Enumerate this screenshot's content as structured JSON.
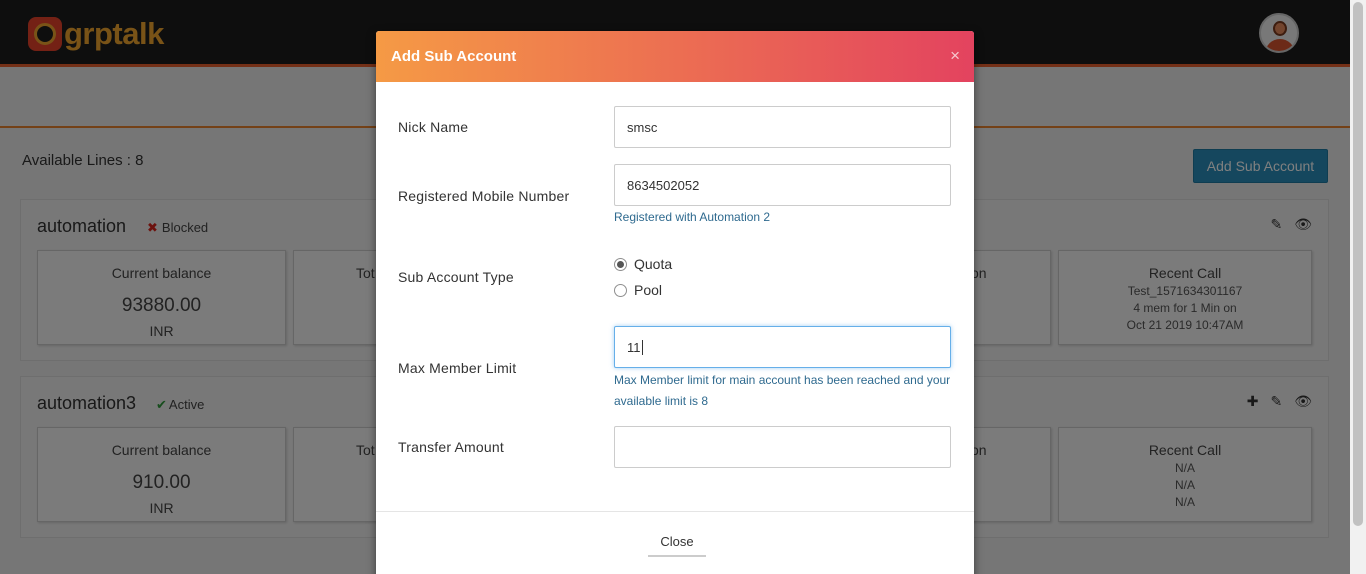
{
  "app": {
    "logo_text": "grptalk"
  },
  "page": {
    "available_lines_label": "Available Lines : 8",
    "add_sub_account_label": "Add Sub Account"
  },
  "accounts": [
    {
      "name": "automation",
      "status": "Blocked",
      "current_balance_title": "Current balance",
      "current_balance_value": "93880.00",
      "current_balance_unit": "INR",
      "partial_tile_1": "Tot",
      "partial_tile_3": "tion",
      "recent_call_title": "Recent Call",
      "recent_call_lines": [
        "Test_1571634301167",
        "4 mem for 1 Min on",
        "Oct 21 2019 10:47AM"
      ]
    },
    {
      "name": "automation3",
      "status": "Active",
      "current_balance_title": "Current balance",
      "current_balance_value": "910.00",
      "current_balance_unit": "INR",
      "partial_tile_1": "Tot",
      "partial_tile_3": "tion",
      "recent_call_title": "Recent Call",
      "recent_call_lines": [
        "N/A",
        "N/A",
        "N/A"
      ]
    }
  ],
  "modal": {
    "title": "Add Sub Account",
    "close_x": "×",
    "nick_name": {
      "label": "Nick Name",
      "value": "smsc"
    },
    "mobile": {
      "label": "Registered Mobile Number",
      "value": "8634502052",
      "help": "Registered with Automation 2"
    },
    "account_type": {
      "label": "Sub Account Type",
      "options": [
        "Quota",
        "Pool"
      ],
      "selected": "Quota"
    },
    "max_member": {
      "label": "Max Member Limit",
      "value": "11",
      "help": "Max Member limit for main account has been reached and your available limit is 8"
    },
    "transfer": {
      "label": "Transfer Amount",
      "value": ""
    },
    "close_label": "Close"
  },
  "colors": {
    "accent_orange": "#e8612f",
    "header_gradient_start": "#f59a45",
    "header_gradient_end": "#e3435f",
    "button_blue": "#2a8fbd",
    "help_text": "#2f6a8f"
  }
}
